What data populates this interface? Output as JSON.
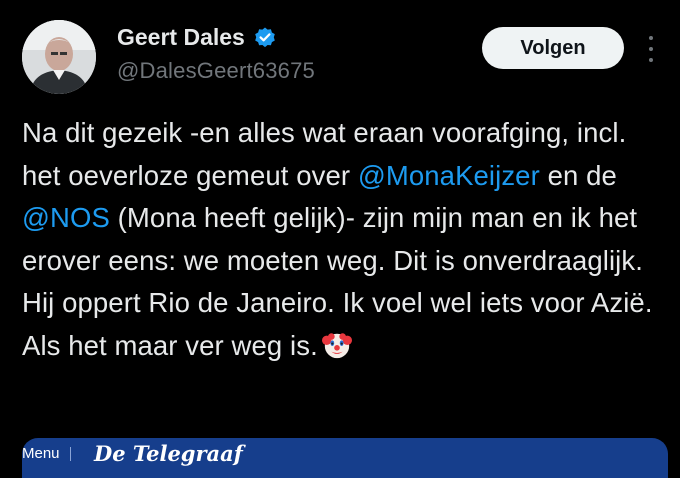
{
  "author": {
    "name": "Geert Dales",
    "handle": "@DalesGeert63675",
    "verified": true,
    "avatar_icon": "profile-photo-avatar"
  },
  "actions": {
    "follow_label": "Volgen",
    "more_icon": "vertical-ellipsis-icon"
  },
  "tweet": {
    "segments": [
      {
        "type": "text",
        "text": "Na dit gezeik -en alles wat eraan voorafging, incl. het oeverloze gemeut over "
      },
      {
        "type": "mention",
        "text": "@MonaKeijzer"
      },
      {
        "type": "text",
        "text": " en de "
      },
      {
        "type": "mention",
        "text": "@NOS"
      },
      {
        "type": "text",
        "text": " (Mona heeft gelijk)- zijn mijn man en ik het erover eens: we moeten weg. Dit is onverdraaglijk. Hij oppert Rio de Janeiro. Ik voel wel iets voor Azië. Als het maar ver weg is."
      }
    ],
    "emoji": "clown-face-emoji"
  },
  "card": {
    "menu_label": "Menu",
    "site_name": "De Telegraaf"
  },
  "colors": {
    "background": "#000000",
    "text": "#e7e9ea",
    "secondary": "#71767b",
    "link": "#1d9bf0",
    "verified": "#1d9bf0",
    "card": "#163e8c"
  }
}
